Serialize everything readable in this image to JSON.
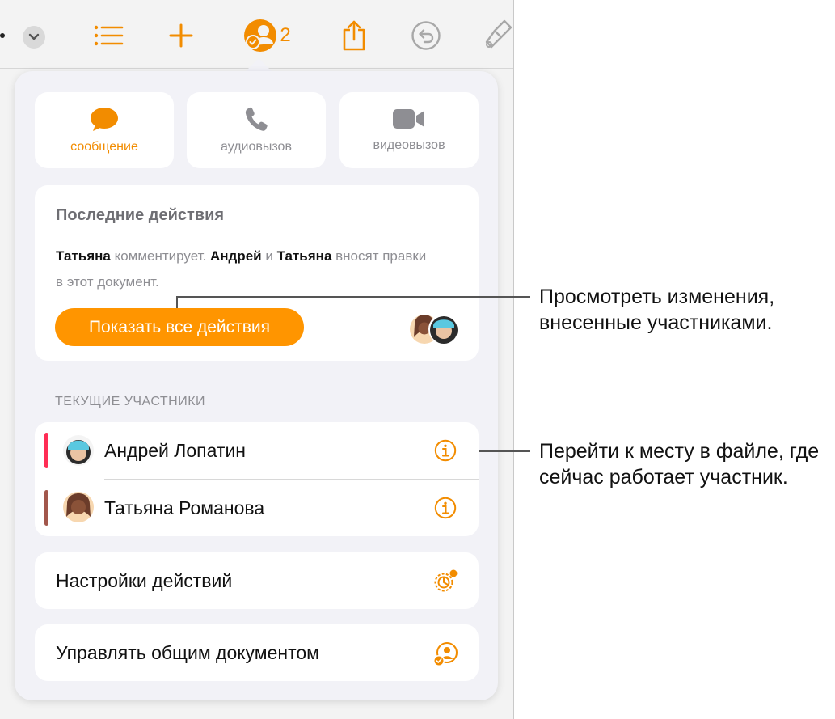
{
  "toolbar": {
    "collaborator_count": "2",
    "icons": [
      "more-dot",
      "chevron-down-icon",
      "list-icon",
      "plus-icon",
      "collaborate-icon",
      "share-icon",
      "undo-icon",
      "format-brush-icon"
    ],
    "accent_color": "#f28c00"
  },
  "popover": {
    "actions": [
      {
        "label": "сообщение",
        "icon": "message-bubble-icon",
        "active": true
      },
      {
        "label": "аудиовызов",
        "icon": "phone-icon",
        "active": false
      },
      {
        "label": "видеовызов",
        "icon": "video-camera-icon",
        "active": false
      }
    ],
    "recent": {
      "title": "Последние действия",
      "name1": "Татьяна",
      "text1": " комментирует. ",
      "name2": "Андрей",
      "text2": " и ",
      "name3": "Татьяна",
      "text3": " вносят правки в этот документ.",
      "button": "Показать все действия"
    },
    "participants_header": "ТЕКУЩИЕ УЧАСТНИКИ",
    "participants": [
      {
        "name": "Андрей Лопатин",
        "bar_color": "#ff2d55"
      },
      {
        "name": "Татьяна Романова",
        "bar_color": "#a2574c"
      }
    ],
    "activity_settings": "Настройки действий",
    "manage_shared": "Управлять общим документом"
  },
  "callouts": {
    "view_changes": "Просмотреть изменения, внесенные участниками.",
    "go_to_location": "Перейти к месту в файле, где сейчас работает участник."
  }
}
